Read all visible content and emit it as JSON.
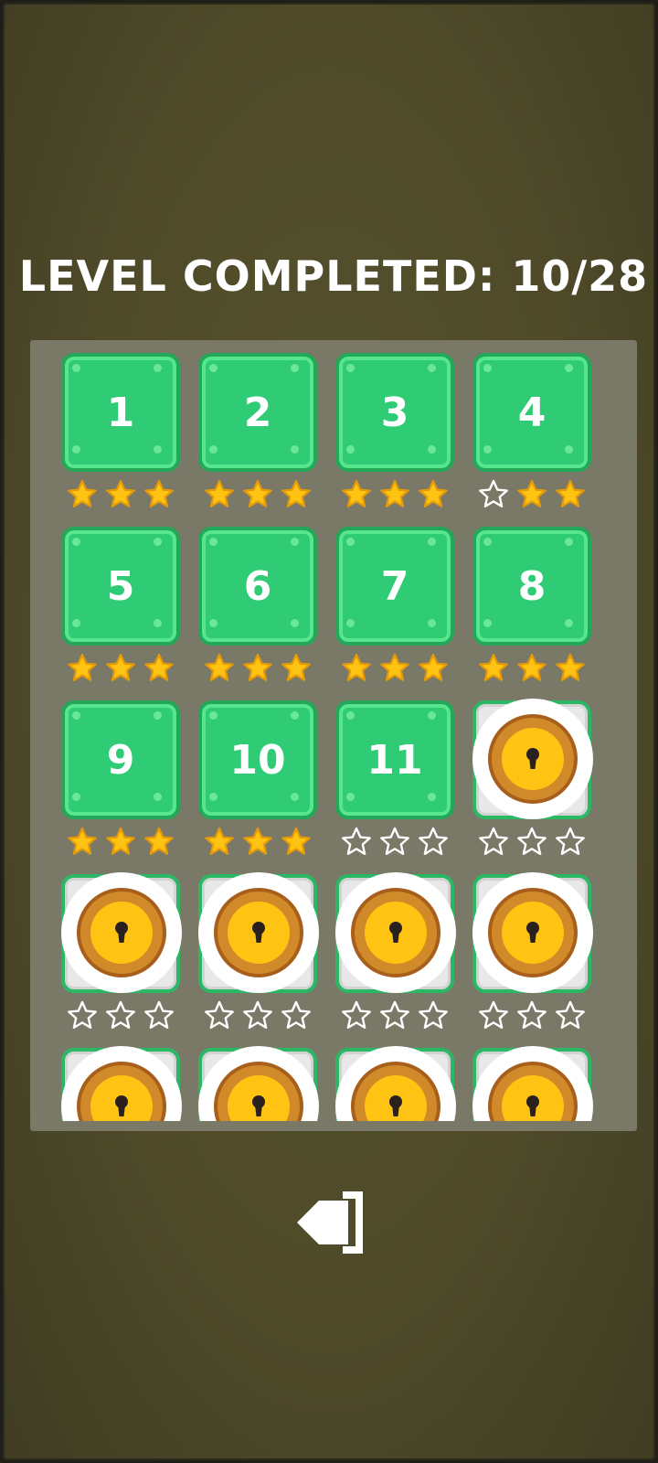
{
  "header": {
    "title": "LEVEL COMPLETED: 10/28"
  },
  "colors": {
    "background": "#4f4b2a",
    "panel": "#7a7866",
    "tile_green": "#2fcb75",
    "star_filled": "#ffc314",
    "lock_ring": "#d08a2a"
  },
  "levels": [
    {
      "label": "1",
      "locked": false,
      "stars": 3
    },
    {
      "label": "2",
      "locked": false,
      "stars": 3
    },
    {
      "label": "3",
      "locked": false,
      "stars": 3
    },
    {
      "label": "4",
      "locked": false,
      "stars": 2
    },
    {
      "label": "5",
      "locked": false,
      "stars": 3
    },
    {
      "label": "6",
      "locked": false,
      "stars": 3
    },
    {
      "label": "7",
      "locked": false,
      "stars": 3
    },
    {
      "label": "8",
      "locked": false,
      "stars": 3
    },
    {
      "label": "9",
      "locked": false,
      "stars": 3
    },
    {
      "label": "10",
      "locked": false,
      "stars": 3
    },
    {
      "label": "11",
      "locked": false,
      "stars": 0
    },
    {
      "label": "",
      "locked": true,
      "stars": 0
    },
    {
      "label": "",
      "locked": true,
      "stars": 0
    },
    {
      "label": "",
      "locked": true,
      "stars": 0
    },
    {
      "label": "",
      "locked": true,
      "stars": 0
    },
    {
      "label": "",
      "locked": true,
      "stars": 0
    },
    {
      "label": "",
      "locked": true,
      "stars": 0
    },
    {
      "label": "",
      "locked": true,
      "stars": 0
    },
    {
      "label": "",
      "locked": true,
      "stars": 0
    },
    {
      "label": "",
      "locked": true,
      "stars": 0
    }
  ],
  "footer": {
    "exit_icon": "exit-icon"
  }
}
